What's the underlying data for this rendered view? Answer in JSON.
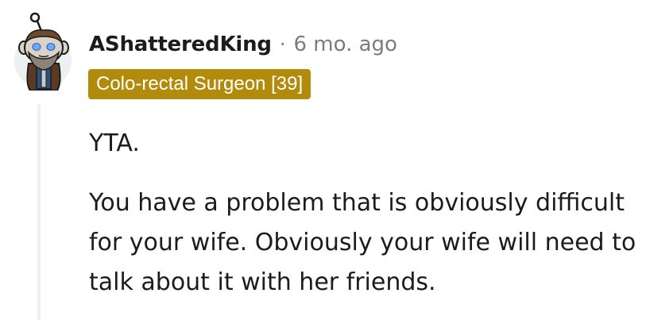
{
  "comment": {
    "author": "AShatteredKing",
    "separator": "·",
    "timestamp": "6 mo. ago",
    "flair": "Colo-rectal Surgeon [39]",
    "paragraphs": [
      "YTA.",
      "You have a problem that is obviously difficult for your wife. Obviously your wife will need to talk about it with her friends."
    ]
  },
  "colors": {
    "flair_background": "#b28b0d",
    "flair_text": "#ffffff",
    "thread_line": "#edeff1",
    "muted_text": "#7c7c7c",
    "body_text": "#1c1c1c"
  },
  "icons": {
    "avatar": "snoo-avatar-bearded-knight"
  }
}
